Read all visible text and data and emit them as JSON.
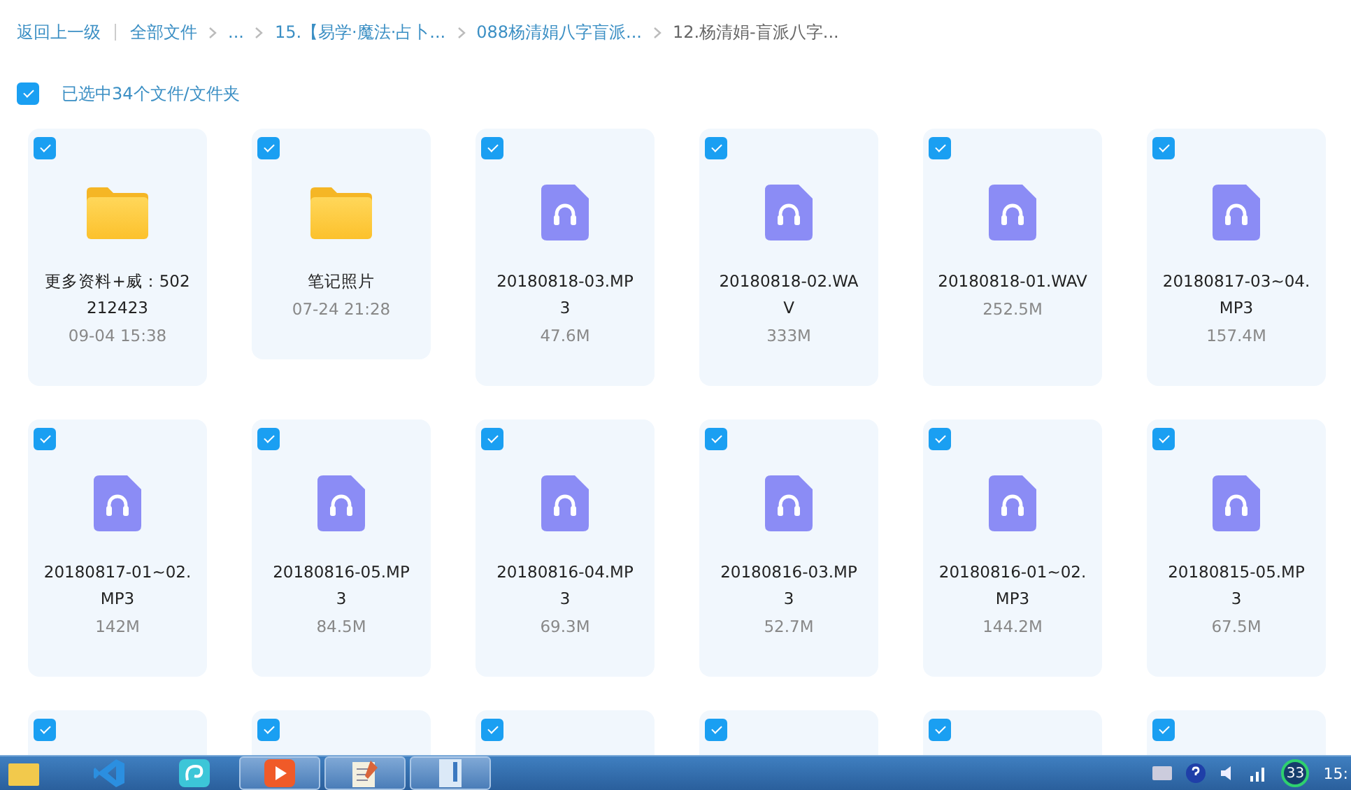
{
  "breadcrumb": {
    "back": "返回上一级",
    "items": [
      {
        "label": "全部文件",
        "current": false
      },
      {
        "label": "...",
        "current": false
      },
      {
        "label": "15.【易学·魔法·占卜...",
        "current": false
      },
      {
        "label": "088杨清娟八字盲派...",
        "current": false
      },
      {
        "label": "12.杨清娟-盲派八字...",
        "current": true
      }
    ]
  },
  "select_all": {
    "checked": true,
    "label": "已选中34个文件/文件夹"
  },
  "files": [
    {
      "kind": "folder",
      "selected": true,
      "name": "更多资料+威：502\n212423",
      "meta": "09-04 15:38"
    },
    {
      "kind": "folder",
      "selected": true,
      "name": "笔记照片",
      "meta": "07-24 21:28"
    },
    {
      "kind": "audio",
      "selected": true,
      "name": "20180818-03.MP\n3",
      "meta": "47.6M"
    },
    {
      "kind": "audio",
      "selected": true,
      "name": "20180818-02.WA\nV",
      "meta": "333M"
    },
    {
      "kind": "audio",
      "selected": true,
      "name": "20180818-01.WAV",
      "meta": "252.5M"
    },
    {
      "kind": "audio",
      "selected": true,
      "name": "20180817-03~04.\nMP3",
      "meta": "157.4M"
    },
    {
      "kind": "audio",
      "selected": true,
      "name": "20180817-01~02.\nMP3",
      "meta": "142M"
    },
    {
      "kind": "audio",
      "selected": true,
      "name": "20180816-05.MP\n3",
      "meta": "84.5M"
    },
    {
      "kind": "audio",
      "selected": true,
      "name": "20180816-04.MP\n3",
      "meta": "69.3M"
    },
    {
      "kind": "audio",
      "selected": true,
      "name": "20180816-03.MP\n3",
      "meta": "52.7M"
    },
    {
      "kind": "audio",
      "selected": true,
      "name": "20180816-01~02.\nMP3",
      "meta": "144.2M"
    },
    {
      "kind": "audio",
      "selected": true,
      "name": "20180815-05.MP\n3",
      "meta": "67.5M"
    },
    {
      "selected": true
    },
    {
      "selected": true
    },
    {
      "selected": true
    },
    {
      "selected": true
    },
    {
      "selected": true
    },
    {
      "selected": true
    }
  ],
  "taskbar": {
    "apps": [
      {
        "kind": "folder",
        "active": false
      },
      {
        "kind": "code",
        "active": false
      },
      {
        "kind": "swirl",
        "active": false
      },
      {
        "kind": "play",
        "active": true
      },
      {
        "kind": "notepad",
        "active": true
      },
      {
        "kind": "doc",
        "active": true
      }
    ],
    "badge": "33",
    "clock": "15:"
  }
}
